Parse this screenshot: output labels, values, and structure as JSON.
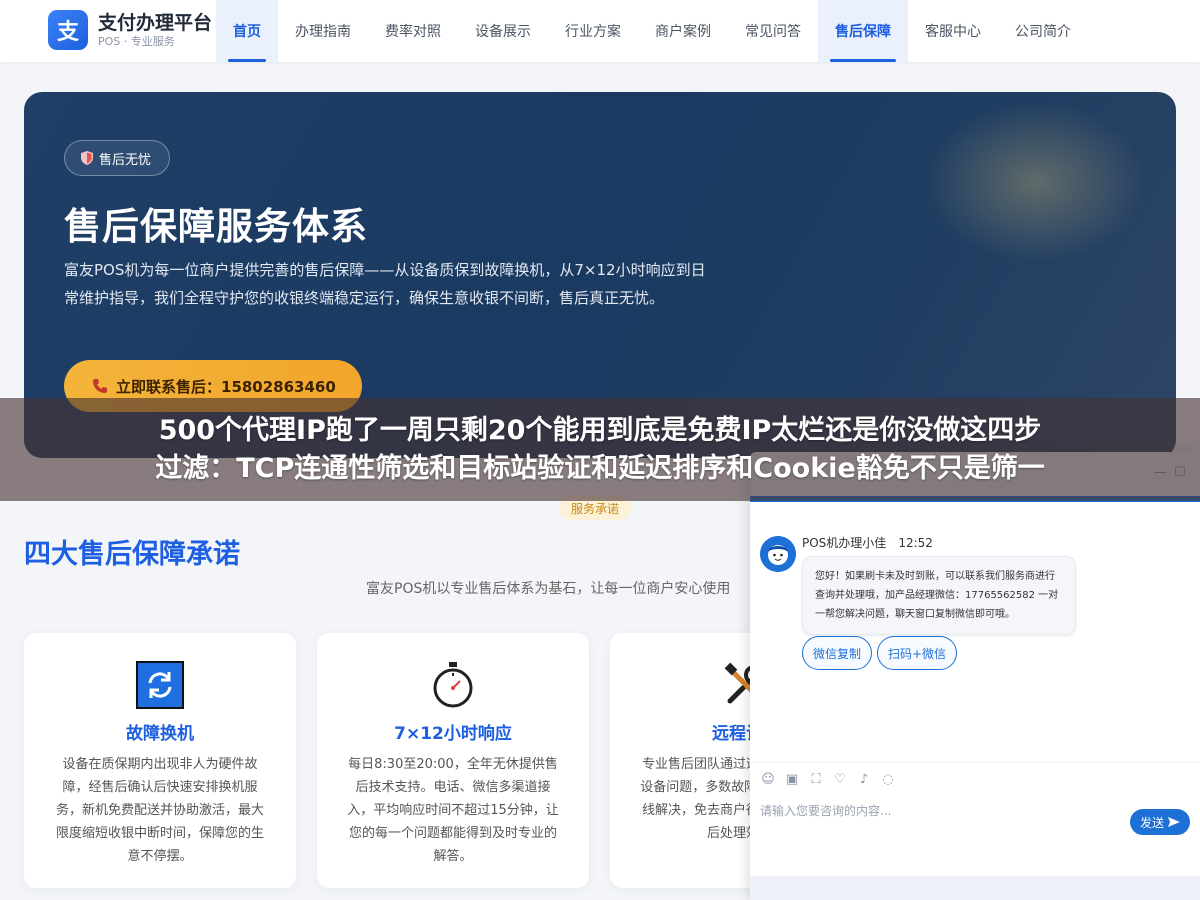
{
  "brand": {
    "icon_char": "支",
    "title": "支付办理平台",
    "subtitle": "POS · 专业服务"
  },
  "nav": [
    {
      "label": "首页",
      "active": true
    },
    {
      "label": "办理指南",
      "active": false
    },
    {
      "label": "费率对照",
      "active": false
    },
    {
      "label": "设备展示",
      "active": false
    },
    {
      "label": "行业方案",
      "active": false
    },
    {
      "label": "商户案例",
      "active": false
    },
    {
      "label": "常见问答",
      "active": false
    },
    {
      "label": "售后保障",
      "active": true
    },
    {
      "label": "客服中心",
      "active": false
    },
    {
      "label": "公司简介",
      "active": false
    }
  ],
  "hero": {
    "badge": "售后无忧",
    "title": "售后保障服务体系",
    "desc": "富友POS机为每一位商户提供完善的售后保障——从设备质保到故障换机，从7×12小时响应到日常维护指导，我们全程守护您的收银终端稳定运行，确保生意收银不间断，售后真正无忧。",
    "cta": "立即联系售后：15802863460"
  },
  "overlay": {
    "line1": "500个代理IP跑了一周只剩20个能用到底是免费IP太烂还是你没做这四步",
    "line2": "过滤：TCP连通性筛选和目标站验证和延迟排序和Cookie豁免不只是筛一"
  },
  "section": {
    "tag": "服务承诺",
    "title": "四大售后保障承诺",
    "subtitle": "富友POS机以专业售后体系为基石，让每一位商户安心使用"
  },
  "cards": [
    {
      "icon": "refresh-icon",
      "title": "故障换机",
      "text": "设备在质保期内出现非人为硬件故障，经售后确认后快速安排换机服务，新机免费配送并协助激活，最大限度缩短收银中断时间，保障您的生意不停摆。"
    },
    {
      "icon": "stopwatch-icon",
      "title": "7×12小时响应",
      "text": "每日8:30至20:00，全年无休提供售后技术支持。电话、微信多渠道接入，平均响应时间不超过15分钟，让您的每一个问题都能得到及时专业的解答。"
    },
    {
      "icon": "tools-icon",
      "title": "远程诊断",
      "text": "专业售后团队通过远程方式快速定位设备问题，多数故障可在30分钟内在线解决，免去商户往返等待，提升售后处理效率。"
    }
  ],
  "chat": {
    "agent_name": "POS机办理小佳",
    "time": "12:52",
    "message": "您好！如果刷卡未及时到账，可以联系我们服务商进行查询并处理哦，加产品经理微信：17765562582 一对一帮您解决问题，聊天窗口复制微信即可哦。",
    "quick_replies": [
      "微信复制",
      "扫码+微信"
    ],
    "input_placeholder": "请输入您要咨询的内容...",
    "send": "发送"
  },
  "colors": {
    "primary": "#1d5fe0",
    "hero_bg": "#1f3f67",
    "cta": "#f4b43a",
    "chat_accent": "#1d70d6"
  }
}
